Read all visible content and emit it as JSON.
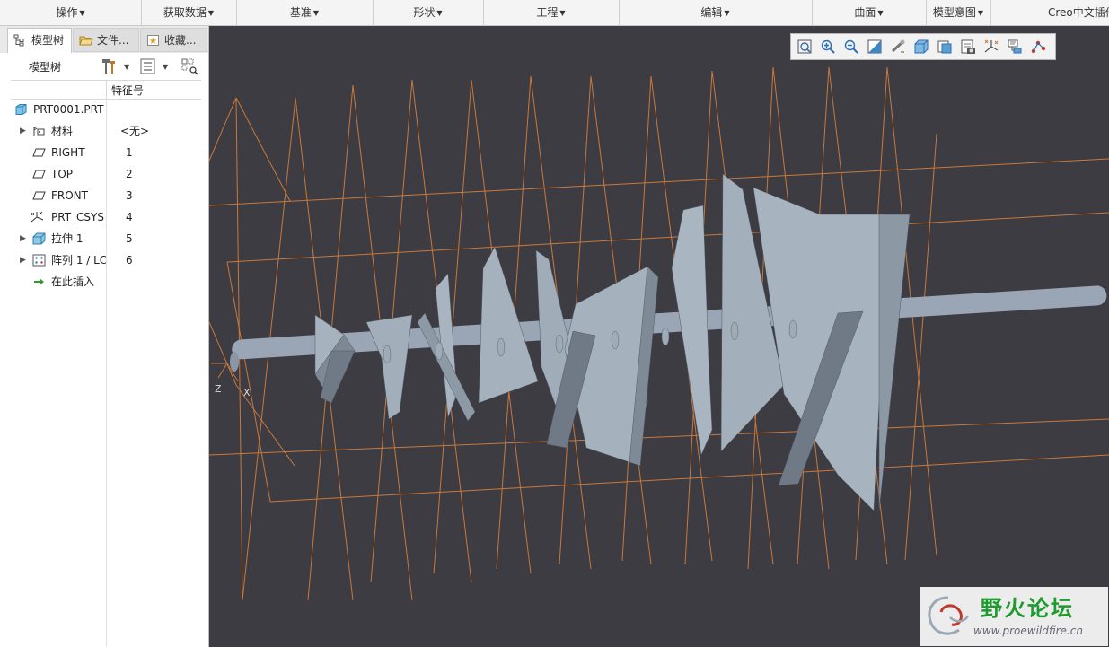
{
  "ribbon": {
    "groups": [
      {
        "label": "操作"
      },
      {
        "label": "获取数据"
      },
      {
        "label": "基准"
      },
      {
        "label": "形状"
      },
      {
        "label": "工程"
      },
      {
        "label": "编辑"
      },
      {
        "label": "曲面"
      },
      {
        "label": "模型意图"
      },
      {
        "label": "Creo中文插件"
      }
    ]
  },
  "left_panel": {
    "tabs": [
      {
        "label": "模型树",
        "icon": "tree-icon",
        "active": true
      },
      {
        "label": "文件...",
        "icon": "folder-icon",
        "active": false
      },
      {
        "label": "收藏...",
        "icon": "favorites-icon",
        "active": false
      }
    ],
    "toolbar": {
      "label": "模型树",
      "buttons": [
        {
          "icon": "settings-tools-icon",
          "dropdown": true
        },
        {
          "icon": "show-list-icon",
          "dropdown": true
        },
        {
          "icon": "filter-icon",
          "dropdown": false
        }
      ]
    },
    "column_header": "特征号",
    "tree": [
      {
        "name": "PRT0001.PRT",
        "icon": "part-icon",
        "number": "",
        "expandable": false,
        "level": 0
      },
      {
        "name": "材料",
        "icon": "material-icon",
        "number": "<无>",
        "expandable": true,
        "level": 1
      },
      {
        "name": "RIGHT",
        "icon": "datum-plane-icon",
        "number": "1",
        "expandable": false,
        "level": 1
      },
      {
        "name": "TOP",
        "icon": "datum-plane-icon",
        "number": "2",
        "expandable": false,
        "level": 1
      },
      {
        "name": "FRONT",
        "icon": "datum-plane-icon",
        "number": "3",
        "expandable": false,
        "level": 1
      },
      {
        "name": "PRT_CSYS_",
        "icon": "csys-icon",
        "number": "4",
        "expandable": false,
        "level": 1
      },
      {
        "name": "拉伸 1",
        "icon": "extrude-icon",
        "number": "5",
        "expandable": true,
        "level": 1
      },
      {
        "name": "阵列 1 / LC",
        "icon": "pattern-icon",
        "number": "6",
        "expandable": true,
        "level": 1
      },
      {
        "name": "在此插入",
        "icon": "insert-arrow-icon",
        "number": "",
        "expandable": false,
        "level": 1
      }
    ]
  },
  "viewport": {
    "background": "#3d3c43",
    "datum_color": "#c9793a",
    "model_color": "#9aa6b5",
    "csys_labels": {
      "z": "Z",
      "x": "X"
    },
    "view_toolbar": [
      {
        "icon": "refit-icon"
      },
      {
        "icon": "zoom-in-icon"
      },
      {
        "icon": "zoom-out-icon"
      },
      {
        "icon": "repaint-icon"
      },
      {
        "icon": "spin-center-icon"
      },
      {
        "icon": "display-style-icon"
      },
      {
        "icon": "saved-orientations-icon"
      },
      {
        "icon": "view-manager-icon"
      },
      {
        "icon": "datum-display-icon"
      },
      {
        "icon": "annotation-display-icon"
      },
      {
        "icon": "sketch-display-icon"
      }
    ]
  },
  "watermark": {
    "title": "野火论坛",
    "url": "www.proewildfire.cn"
  }
}
